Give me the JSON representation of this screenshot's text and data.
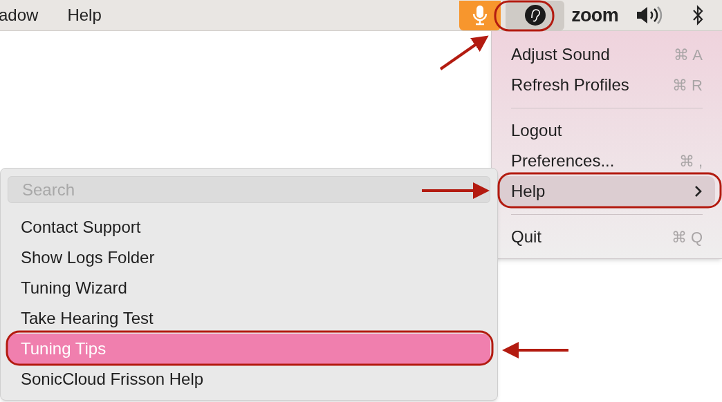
{
  "menubar": {
    "app_menus": [
      "adow",
      "Help"
    ],
    "status_items": [
      {
        "kind": "mic",
        "selected": false
      },
      {
        "kind": "app",
        "selected": true
      },
      {
        "kind": "zoom",
        "label": "zoom",
        "selected": false
      },
      {
        "kind": "speaker",
        "selected": false
      },
      {
        "kind": "bluetooth",
        "selected": false
      }
    ]
  },
  "main_menu": {
    "items": [
      {
        "kind": "item",
        "label": "Adjust Sound",
        "shortcut": "⌘ A",
        "selected": false
      },
      {
        "kind": "item",
        "label": "Refresh Profiles",
        "shortcut": "⌘ R",
        "selected": false
      },
      {
        "kind": "separator"
      },
      {
        "kind": "item",
        "label": "Logout",
        "selected": false
      },
      {
        "kind": "item",
        "label": "Preferences...",
        "shortcut": "⌘ ,",
        "selected": false
      },
      {
        "kind": "submenu",
        "label": "Help",
        "selected": true
      },
      {
        "kind": "separator"
      },
      {
        "kind": "item",
        "label": "Quit",
        "shortcut": "⌘ Q",
        "selected": false
      }
    ]
  },
  "submenu": {
    "search": {
      "placeholder": "Search"
    },
    "items": [
      {
        "label": "Contact Support",
        "selected": false
      },
      {
        "label": "Show Logs Folder",
        "selected": false
      },
      {
        "label": "Tuning Wizard",
        "selected": false
      },
      {
        "label": "Take Hearing Test",
        "selected": false
      },
      {
        "label": "Tuning Tips",
        "selected": true
      },
      {
        "label": "SonicCloud Frisson Help",
        "selected": false
      }
    ]
  }
}
